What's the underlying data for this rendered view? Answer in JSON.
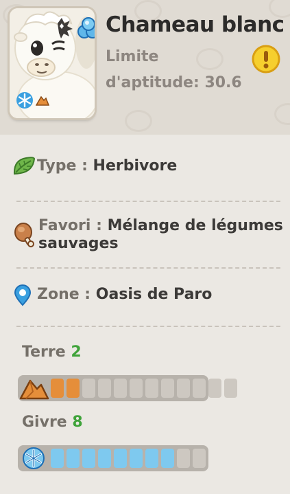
{
  "pal": {
    "name": "Chameau blanc",
    "aptitude_label": "Limite d'aptitude: 30.6"
  },
  "info": {
    "type": {
      "label": "Type :",
      "value": "Herbivore",
      "icon": "leaf-icon"
    },
    "favorite": {
      "label": "Favori :",
      "value": "Mélange de légumes sauvages",
      "icon": "food-icon"
    },
    "zone": {
      "label": "Zone :",
      "value": "Oasis de Paro",
      "icon": "location-pin-icon"
    }
  },
  "skills": [
    {
      "name": "Terre",
      "level": "2",
      "max": 12,
      "filled": 2,
      "icon": "earth-icon",
      "color": "#e58e3a"
    },
    {
      "name": "Givre",
      "level": "8",
      "max": 10,
      "filled": 8,
      "icon": "snowflake-icon",
      "color": "#7ec9ef"
    }
  ],
  "colors": {
    "level_green": "#3fa33a",
    "warning_yellow": "#f6cf2e",
    "earth_orange": "#e58e3a",
    "frost_blue": "#7ec9ef"
  }
}
